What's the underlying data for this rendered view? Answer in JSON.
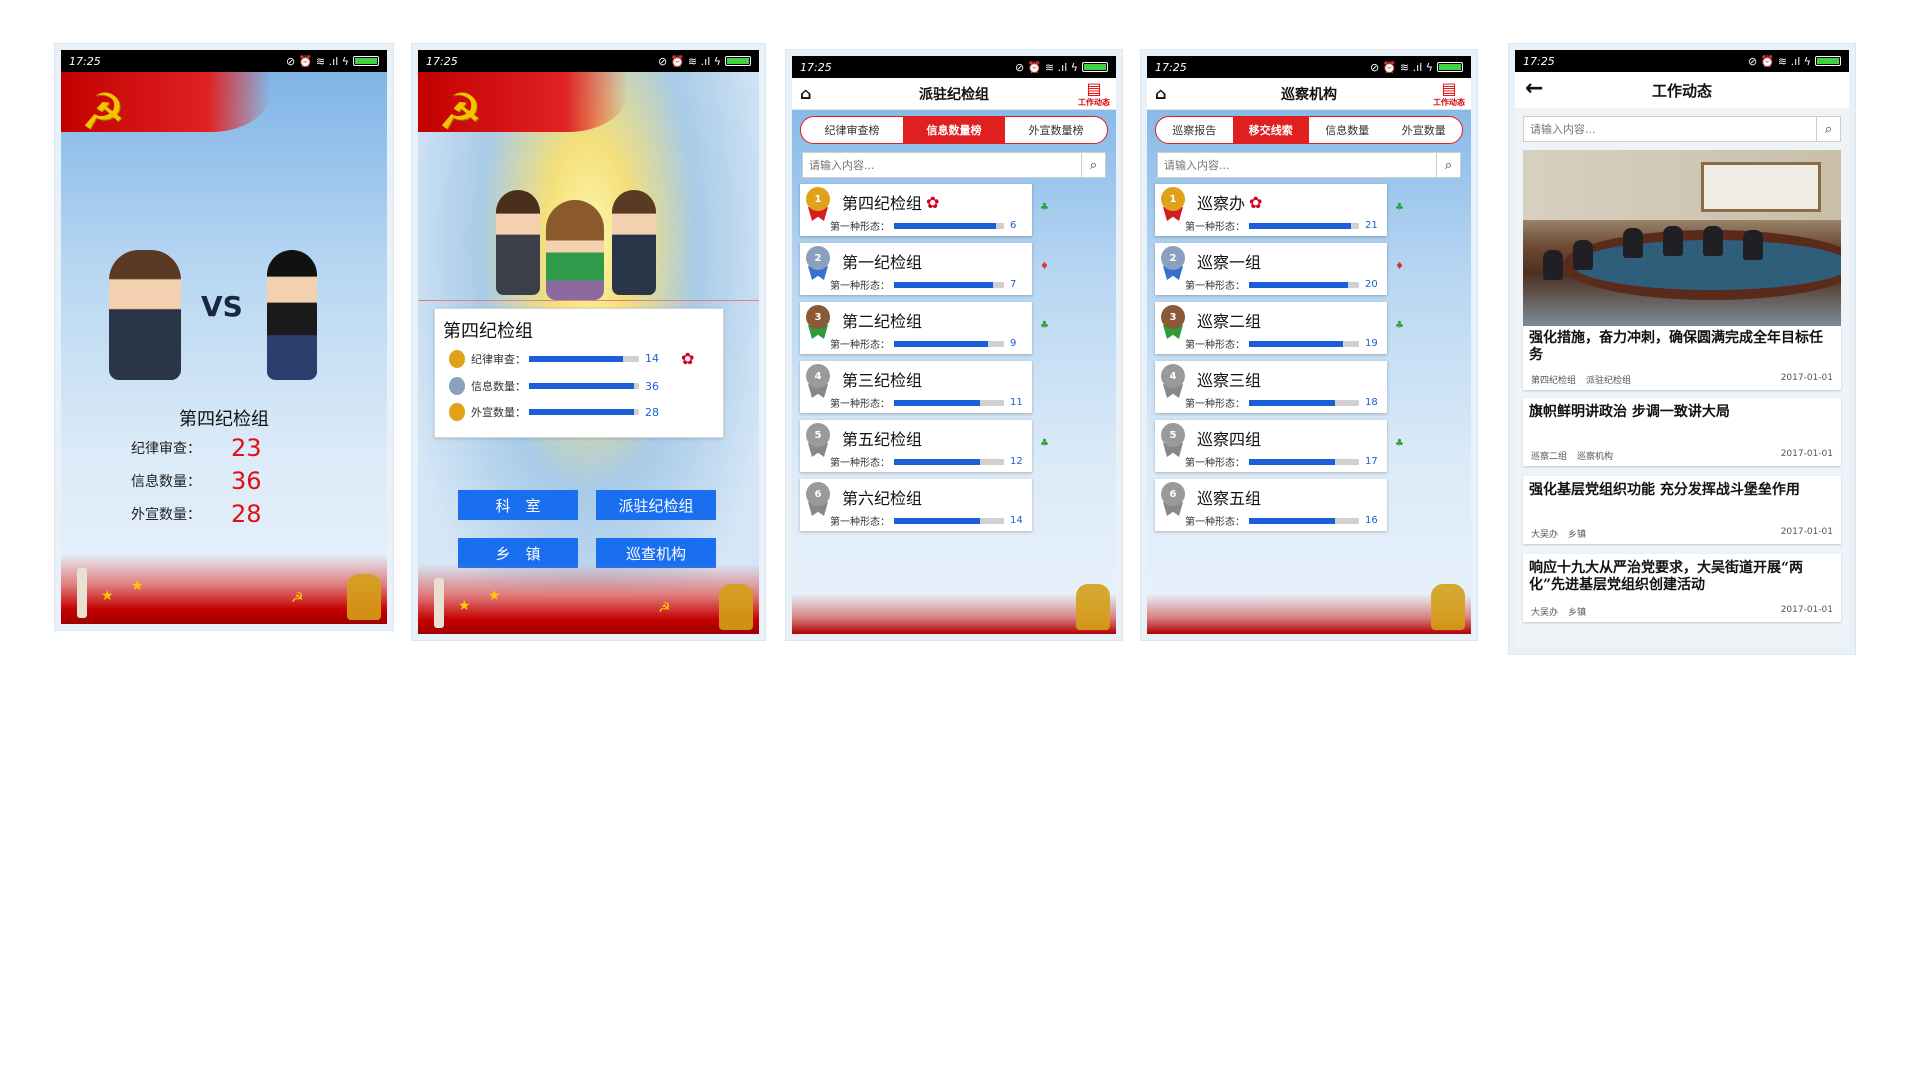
{
  "status": {
    "time": "17:25",
    "icons": "⊘ ⏰ ≋ .ıl ϟ"
  },
  "screen1": {
    "vs": "VS",
    "group_name": "第四纪检组",
    "stats": [
      {
        "label": "纪律审查：",
        "value": "23"
      },
      {
        "label": "信息数量：",
        "value": "36"
      },
      {
        "label": "外宣数量：",
        "value": "28"
      }
    ]
  },
  "screen2": {
    "group_name": "第四纪检组",
    "rows": [
      {
        "label": "纪律审查：",
        "value": "14",
        "progress": 0.85
      },
      {
        "label": "信息数量：",
        "value": "36",
        "progress": 0.95
      },
      {
        "label": "外宣数量：",
        "value": "28",
        "progress": 0.95
      }
    ],
    "buttons": [
      "科　室",
      "派驻纪检组",
      "乡　镇",
      "巡查机构"
    ]
  },
  "screen3": {
    "title": "派驻纪检组",
    "work_label": "工作动态",
    "tabs": [
      "纪律审查榜",
      "信息数量榜",
      "外宣数量榜"
    ],
    "active_tab": 1,
    "search_placeholder": "请输入内容...",
    "items": [
      {
        "rank": "1",
        "name": "第四纪检组",
        "form_label": "第一种形态：",
        "value": "6",
        "progress": 0.93,
        "trend": "up",
        "flower": true
      },
      {
        "rank": "2",
        "name": "第一纪检组",
        "form_label": "第一种形态：",
        "value": "7",
        "progress": 0.9,
        "trend": "down",
        "flower": false
      },
      {
        "rank": "3",
        "name": "第二纪检组",
        "form_label": "第一种形态：",
        "value": "9",
        "progress": 0.85,
        "trend": "up",
        "flower": false
      },
      {
        "rank": "4",
        "name": "第三纪检组",
        "form_label": "第一种形态：",
        "value": "11",
        "progress": 0.78,
        "trend": "",
        "flower": false
      },
      {
        "rank": "5",
        "name": "第五纪检组",
        "form_label": "第一种形态：",
        "value": "12",
        "progress": 0.78,
        "trend": "up",
        "flower": false
      },
      {
        "rank": "6",
        "name": "第六纪检组",
        "form_label": "第一种形态：",
        "value": "14",
        "progress": 0.78,
        "trend": "",
        "flower": false
      }
    ]
  },
  "screen4": {
    "title": "巡察机构",
    "work_label": "工作动态",
    "tabs": [
      "巡察报告",
      "移交线索",
      "信息数量",
      "外宣数量"
    ],
    "active_tab": 1,
    "search_placeholder": "请输入内容...",
    "items": [
      {
        "rank": "1",
        "name": "巡察办",
        "form_label": "第一种形态：",
        "value": "21",
        "progress": 0.93,
        "trend": "up",
        "flower": true
      },
      {
        "rank": "2",
        "name": "巡察一组",
        "form_label": "第一种形态：",
        "value": "20",
        "progress": 0.9,
        "trend": "down",
        "flower": false
      },
      {
        "rank": "3",
        "name": "巡察二组",
        "form_label": "第一种形态：",
        "value": "19",
        "progress": 0.85,
        "trend": "up",
        "flower": false
      },
      {
        "rank": "4",
        "name": "巡察三组",
        "form_label": "第一种形态：",
        "value": "18",
        "progress": 0.78,
        "trend": "",
        "flower": false
      },
      {
        "rank": "5",
        "name": "巡察四组",
        "form_label": "第一种形态：",
        "value": "17",
        "progress": 0.78,
        "trend": "up",
        "flower": false
      },
      {
        "rank": "6",
        "name": "巡察五组",
        "form_label": "第一种形态：",
        "value": "16",
        "progress": 0.78,
        "trend": "",
        "flower": false
      }
    ]
  },
  "screen5": {
    "title": "工作动态",
    "search_placeholder": "请输入内容...",
    "news": [
      {
        "title": "强化措施，奋力冲刺，确保圆满完成全年目标任务",
        "tags": [
          "第四纪检组",
          "派驻纪检组"
        ],
        "date": "2017-01-01"
      },
      {
        "title": "旗帜鲜明讲政治 步调一致讲大局",
        "tags": [
          "巡察二组",
          "巡察机构"
        ],
        "date": "2017-01-01"
      },
      {
        "title": "强化基层党组织功能 充分发挥战斗堡垒作用",
        "tags": [
          "大吴办",
          "乡镇"
        ],
        "date": "2017-01-01"
      },
      {
        "title": "响应十九大从严治党要求，大吴街道开展“两化”先进基层党组织创建活动",
        "tags": [
          "大吴办",
          "乡镇"
        ],
        "date": "2017-01-01"
      }
    ]
  },
  "colors": {
    "red": "#e02020",
    "blue": "#1a6ff0",
    "bar_blue": "#1a5fd6",
    "gold": "#e0a21a",
    "silver": "#8aa0bd",
    "bronze": "#8a5a36",
    "grey": "#9a9a9a"
  }
}
